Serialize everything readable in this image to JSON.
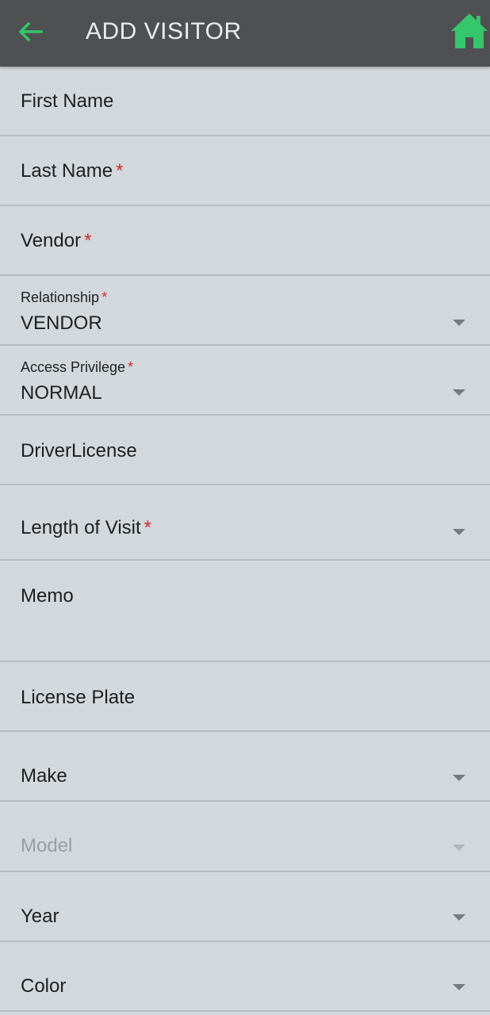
{
  "header": {
    "title": "ADD VISITOR",
    "back_icon": "arrow-left-icon",
    "home_icon": "home-icon",
    "accent_color": "#34c76b",
    "bar_color": "#4f5052"
  },
  "required_marker": "*",
  "form": {
    "first_name": {
      "label": "First Name"
    },
    "last_name": {
      "label": "Last Name"
    },
    "vendor": {
      "label": "Vendor"
    },
    "relationship": {
      "label": "Relationship",
      "value": "VENDOR"
    },
    "access_privilege": {
      "label": "Access Privilege",
      "value": "NORMAL"
    },
    "driver_license": {
      "label": "DriverLicense"
    },
    "length_of_visit": {
      "label": "Length of Visit"
    },
    "memo": {
      "label": "Memo"
    },
    "license_plate": {
      "label": "License Plate"
    },
    "make": {
      "label": "Make"
    },
    "model": {
      "label": "Model"
    },
    "year": {
      "label": "Year"
    },
    "color": {
      "label": "Color"
    }
  }
}
